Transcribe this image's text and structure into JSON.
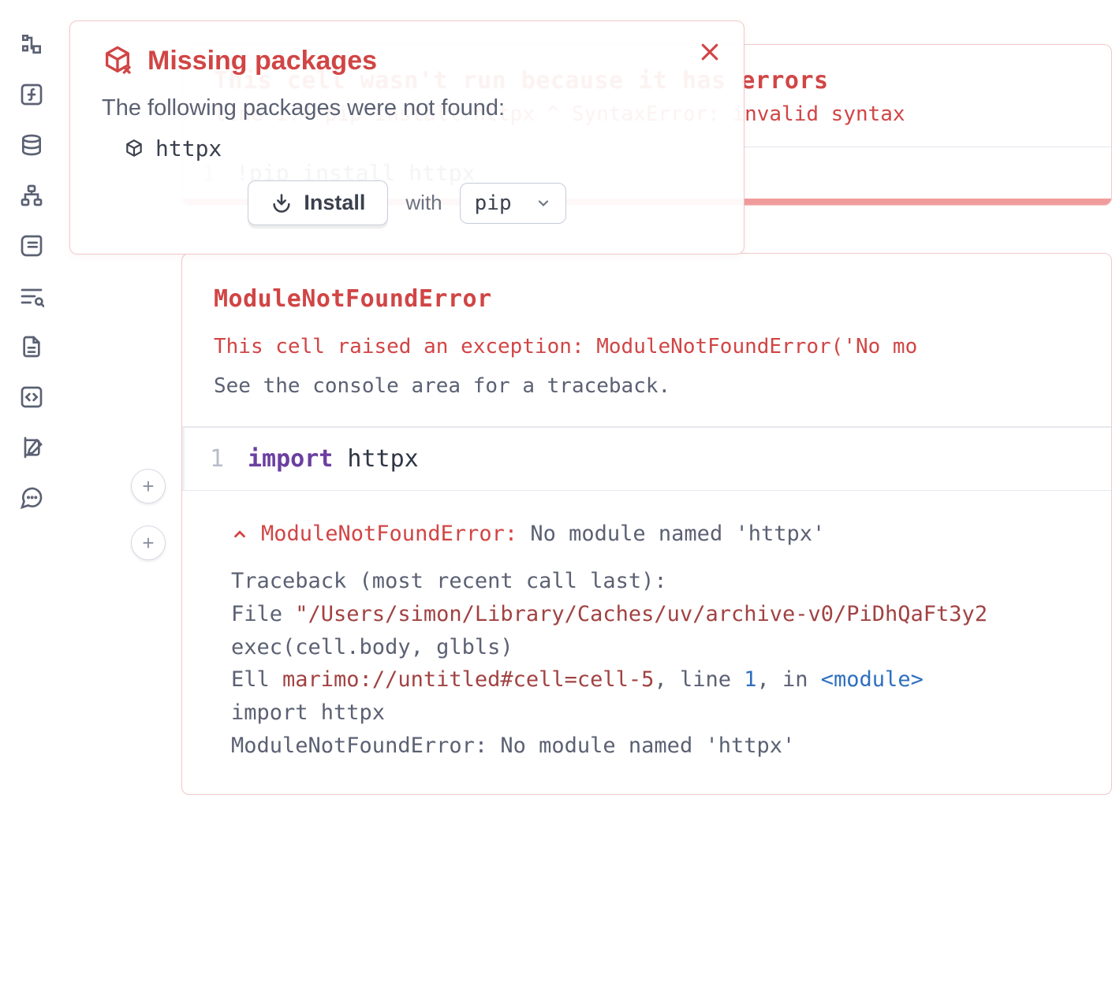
{
  "sidebar": {
    "items": [
      {
        "name": "tree-icon"
      },
      {
        "name": "function-icon"
      },
      {
        "name": "database-icon"
      },
      {
        "name": "graph-icon"
      },
      {
        "name": "scroll-icon"
      },
      {
        "name": "filter-search-icon"
      },
      {
        "name": "document-icon"
      },
      {
        "name": "code-icon"
      },
      {
        "name": "scratchpad-icon"
      },
      {
        "name": "chat-icon"
      }
    ]
  },
  "modal": {
    "title": "Missing packages",
    "subtitle": "The following packages were not found:",
    "packages": [
      "httpx"
    ],
    "install_label": "Install",
    "with_label": "with",
    "installer_selected": "pip"
  },
  "cell1": {
    "error_title": "This cell wasn't run because it has errors",
    "error_msg": "line 1:4 pip install httpx ^ SyntaxError: invalid syntax",
    "line_no": "1",
    "code": "!pip install httpx"
  },
  "cell2": {
    "error_title": "ModuleNotFoundError",
    "msg1": "This cell raised an exception: ModuleNotFoundError('No mo",
    "msg2": "See the console area for a traceback.",
    "line_no": "1",
    "code_kw": "import",
    "code_rest": " httpx",
    "tb": {
      "err_name": "ModuleNotFoundError:",
      "err_detail": " No module named 'httpx'",
      "head": "Traceback (most recent call last):",
      "file_kw": "  File ",
      "file_path": "\"/Users/simon/Library/Caches/uv/archive-v0/PiDhQaFt3y2",
      "exec_line": "    exec(cell.body, glbls)",
      "cell_kw": "  Ell ",
      "cell_path": "marimo://untitled#cell=cell-5",
      "cell_mid": ", line ",
      "cell_line": "1",
      "cell_mid2": ", in ",
      "cell_mod": "<module>",
      "import_line": "    import httpx",
      "final": "ModuleNotFoundError: No module named 'httpx'"
    }
  },
  "addbtn_label": "+"
}
